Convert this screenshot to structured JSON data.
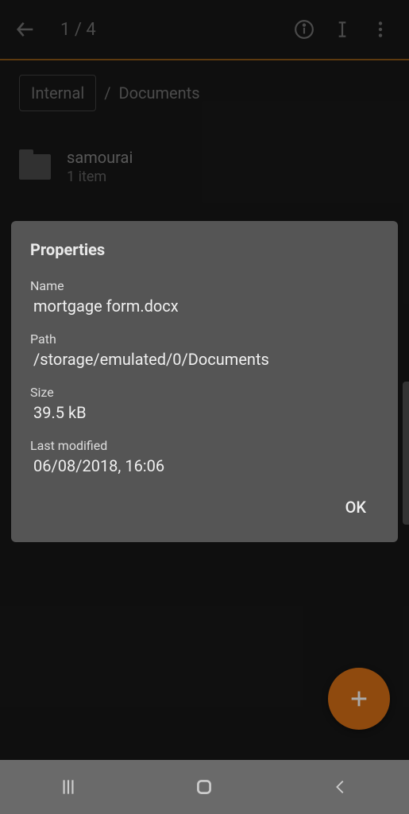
{
  "appbar": {
    "counter": "1 / 4"
  },
  "breadcrumb": {
    "root": "Internal",
    "separator": "/",
    "current": "Documents"
  },
  "folders": [
    {
      "name": "samourai",
      "subtitle": "1 item"
    }
  ],
  "modal": {
    "title": "Properties",
    "fields": {
      "name_label": "Name",
      "name_value": "mortgage form.docx",
      "path_label": "Path",
      "path_value": "/storage/emulated/0/Documents",
      "size_label": "Size",
      "size_value": "39.5 kB",
      "modified_label": "Last modified",
      "modified_value": "06/08/2018, 16:06"
    },
    "ok": "OK"
  }
}
